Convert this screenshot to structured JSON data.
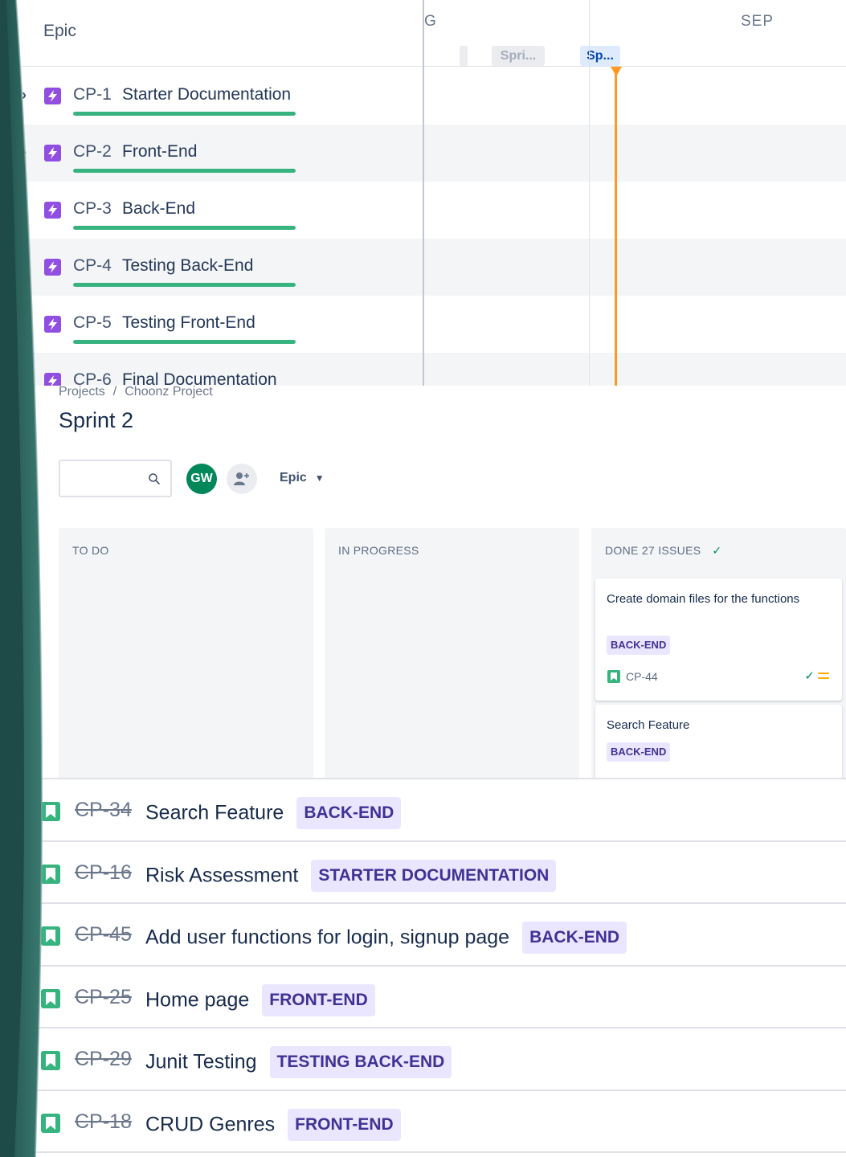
{
  "roadmap": {
    "epic_header": "Epic",
    "months": [
      {
        "label": "G"
      },
      {
        "label": "SEP"
      }
    ],
    "sprints": [
      {
        "label": "Spri..."
      },
      {
        "label": "Sp..."
      }
    ],
    "epics": [
      {
        "key": "CP-1",
        "name": "Starter Documentation",
        "progress": 1.0
      },
      {
        "key": "CP-2",
        "name": "Front-End",
        "progress": 1.0
      },
      {
        "key": "CP-3",
        "name": "Back-End",
        "progress": 1.0
      },
      {
        "key": "CP-4",
        "name": "Testing Back-End",
        "progress": 1.0
      },
      {
        "key": "CP-5",
        "name": "Testing Front-End",
        "progress": 1.0
      },
      {
        "key": "CP-6",
        "name": "Final Documentation",
        "progress": 1.0
      }
    ]
  },
  "board": {
    "breadcrumb": [
      "Projects",
      "Choonz Project"
    ],
    "breadcrumb_sep": "/",
    "title": "Sprint 2",
    "search": {
      "value": "",
      "placeholder": ""
    },
    "avatar_initials": "GW",
    "epic_filter": "Epic",
    "columns": [
      {
        "title": "TO DO"
      },
      {
        "title": "IN PROGRESS"
      },
      {
        "title": "DONE 27 ISSUES"
      }
    ],
    "cards": [
      {
        "summary": "Create domain files for the functions",
        "epic": "BACK-END",
        "key": "CP-44",
        "done_mark": "✓"
      },
      {
        "summary": "Search Feature",
        "epic": "BACK-END"
      }
    ]
  },
  "issues": [
    {
      "key": "CP-34",
      "summary": "Search Feature",
      "epic": "BACK-END"
    },
    {
      "key": "CP-16",
      "summary": "Risk Assessment",
      "epic": "STARTER DOCUMENTATION"
    },
    {
      "key": "CP-45",
      "summary": "Add user functions for login, signup page",
      "epic": "BACK-END"
    },
    {
      "key": "CP-25",
      "summary": "Home page",
      "epic": "FRONT-END"
    },
    {
      "key": "CP-29",
      "summary": "Junit Testing",
      "epic": "TESTING BACK-END"
    },
    {
      "key": "CP-18",
      "summary": "CRUD Genres",
      "epic": "FRONT-END"
    }
  ],
  "colors": {
    "epic_purple": "#904ee2",
    "progress_green": "#36b37e",
    "today_orange": "#ff991f",
    "story_green": "#36b37e",
    "epic_lozenge_bg": "#eae6ff",
    "epic_lozenge_text": "#403294",
    "slide_teal": "#2f6b63"
  }
}
